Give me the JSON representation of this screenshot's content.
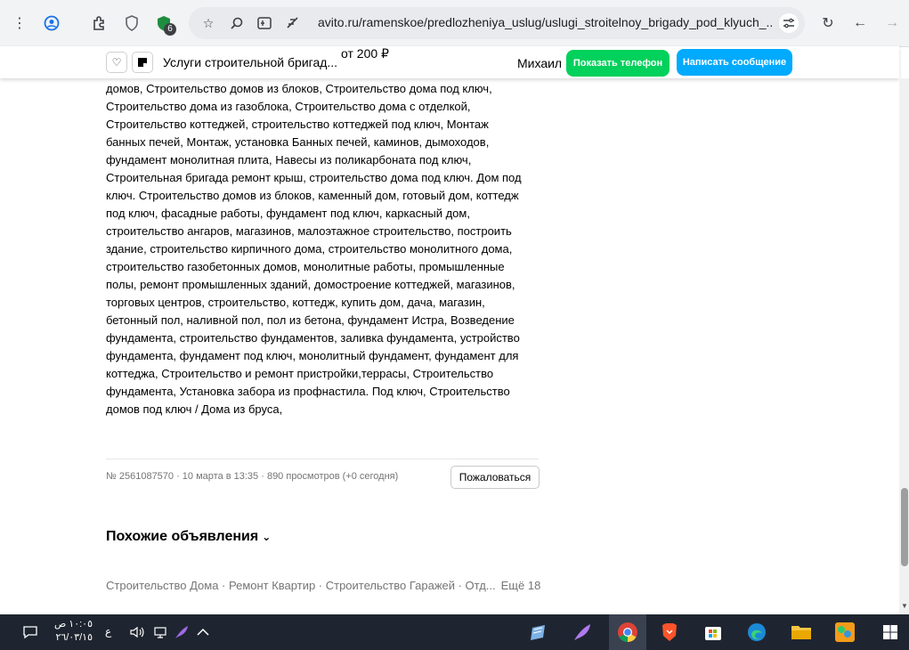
{
  "browser": {
    "url": "avito.ru/ramenskoe/predlozheniya_uslug/uslugi_stroitelnoy_brigady_pod_klyuch_...",
    "extension_badge": "6"
  },
  "sticky_header": {
    "title": "Услуги строительной бригад...",
    "price": "от 200 ₽",
    "seller_name": "Михаил",
    "phone_button": "Показать телефон",
    "message_button": "Написать сообщение",
    "colors": {
      "phone": "#02d15c",
      "message": "#00aaff"
    }
  },
  "description": {
    "lines": [
      "домов, Строительство домов из блоков, Строительство дома под ключ,",
      "Строительство дома из газоблока, Строительство дома с отделкой,",
      "Строительство коттеджей, строительство коттеджей под ключ, Монтаж",
      "банных печей, Монтаж, установка Банных печей, каминов, дымоходов,",
      "фундамент монолитная плита, Навесы из поликарбоната под ключ,",
      "Строительная бригада ремонт крыш, строительство дома под ключ. Дом под",
      "ключ. Строительство домов из блоков, каменный дом, готовый дом, коттедж",
      "под ключ, фасадные работы, фундамент под ключ, каркасный дом,",
      "строительство ангаров, магазинов, малоэтажное строительство, построить",
      "здание, строительство кирпичного дома, строительство монолитного дома,",
      "строительство газобетонных домов, монолитные работы, промышленные",
      "полы, ремонт промышленных зданий, домостроение коттеджей, магазинов,",
      "торговых центров, строительство, коттедж, купить дом, дача, магазин,",
      "бетонный пол, наливной пол, пол из бетона, фундамент Истра, Возведение",
      "фундамента, строительство фундаментов, заливка фундамента, устройство",
      "фундамента, фундамент под ключ, монолитный фундамент, фундамент для",
      "коттеджа, Строительство и ремонт пристройки,террасы, Строительство",
      "фундамента, Установка забора из профнастила. Под ключ, Строительство",
      "домов под ключ / Дома из бруса,"
    ]
  },
  "meta": {
    "text": "№ 2561087570 · 10 марта в 13:35 · 890 просмотров (+0 сегодня)",
    "report_button": "Пожаловаться"
  },
  "similar": {
    "heading": "Похожие объявления",
    "categories": "Строительство Дома · Ремонт Квартир · Строительство Гаражей · Отд...",
    "more": "Ещё 18"
  },
  "taskbar": {
    "time": "١٠:٠٥ ص",
    "date": "٢٦/٠٣/١٥",
    "lang": "ع"
  }
}
